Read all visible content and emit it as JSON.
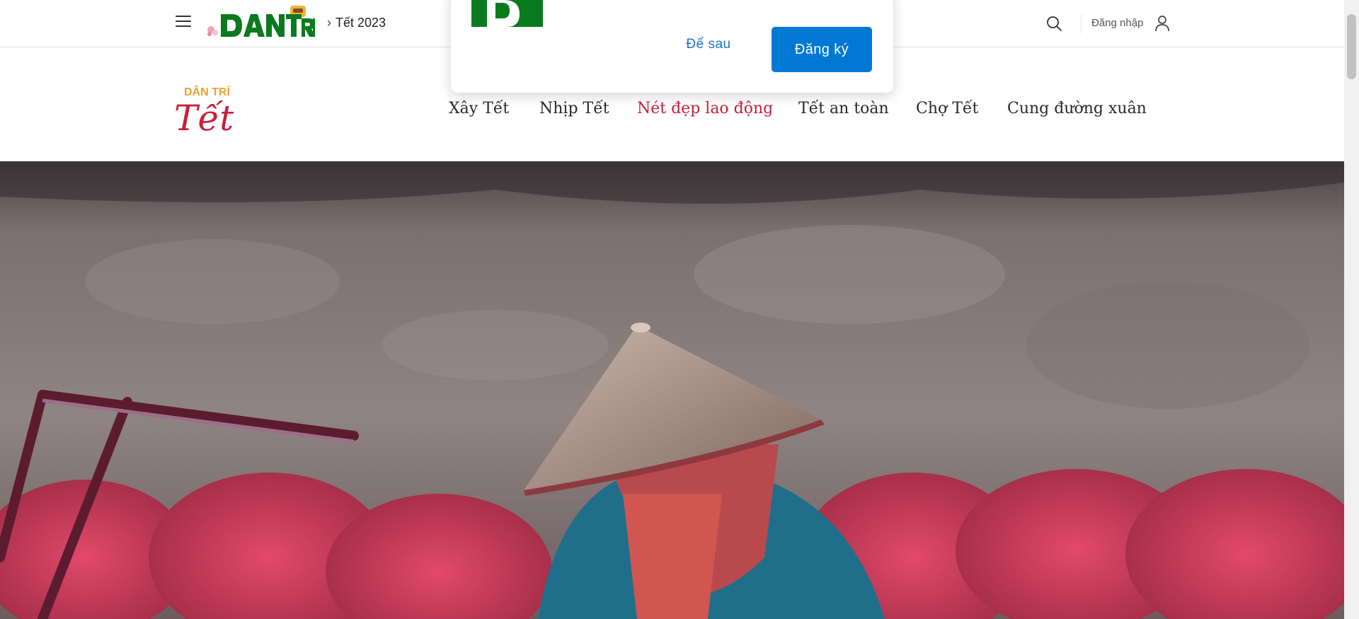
{
  "topbar": {
    "logo_alt": "DÂN TRÍ",
    "breadcrumb": "Tết 2023",
    "login_label": "Đăng nhập",
    "icons": [
      "menu-icon",
      "search-icon",
      "user-icon",
      "chevron-right-icon"
    ]
  },
  "header": {
    "section_logo_alt": "DÂN TRÍ Tết",
    "nav": [
      {
        "label": "Xây Tết",
        "active": false
      },
      {
        "label": "Nhịp Tết",
        "active": false
      },
      {
        "label": "Nét đẹp lao động",
        "active": true
      },
      {
        "label": "Tết an toàn",
        "active": false
      },
      {
        "label": "Chợ Tết",
        "active": false
      },
      {
        "label": "Cung đường xuân",
        "active": false
      }
    ]
  },
  "popup": {
    "later_label": "Để sau",
    "register_label": "Đăng ký"
  },
  "hero": {
    "alt": "Worker in a conical hat beside red incense sticks"
  },
  "colors": {
    "accent_red": "#c8203a",
    "brand_green": "#0a7a1e",
    "button_blue": "#0078d4",
    "link_blue": "#1a73c8"
  }
}
